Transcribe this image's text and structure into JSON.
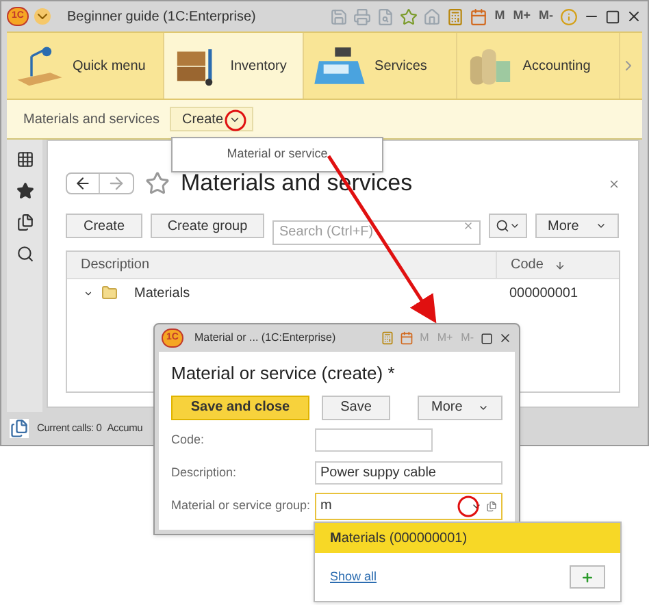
{
  "main_window": {
    "logo": "1C",
    "title": "Beginner guide  (1C:Enterprise)",
    "memory_buttons": [
      "M",
      "M+",
      "M-"
    ]
  },
  "sections": [
    {
      "label": "Quick menu",
      "kind": "lamp",
      "selected": false
    },
    {
      "label": "Inventory",
      "kind": "boxes",
      "selected": true
    },
    {
      "label": "Services",
      "kind": "register",
      "selected": false
    },
    {
      "label": "Accounting",
      "kind": "coins",
      "selected": false
    }
  ],
  "subsection": {
    "label": "Materials and services",
    "create_button": "Create"
  },
  "create_menu": {
    "items": [
      "Material or service"
    ]
  },
  "list_form": {
    "title": "Materials and services",
    "buttons": [
      "Create",
      "Create group"
    ],
    "search": {
      "placeholder": "Search (Ctrl+F)"
    },
    "more_button": "More",
    "table": {
      "columns": [
        "Description",
        "Code"
      ],
      "rows": [
        {
          "description": "Materials",
          "code": "000000001",
          "expanded": true
        }
      ]
    }
  },
  "status_bar": [
    "Current calls: 0",
    "Accumu"
  ],
  "dialog": {
    "logo": "1C",
    "title": "Material or ...  (1C:Enterprise)",
    "memory_buttons": [
      "M",
      "M+",
      "M-"
    ],
    "heading": "Material or service (create) *",
    "primary_button": "Save and close",
    "save_button": "Save",
    "more_button": "More",
    "fields": [
      {
        "label": "Code:"
      },
      {
        "label": "Description:",
        "value": "Power suppy cable"
      },
      {
        "label": "Material or service group:",
        "value": "m",
        "kind": "combo"
      }
    ]
  },
  "choice_list": {
    "items": [
      {
        "label": "**M**aterials (000000001)",
        "selected": true
      }
    ],
    "show_all": "Show all"
  }
}
